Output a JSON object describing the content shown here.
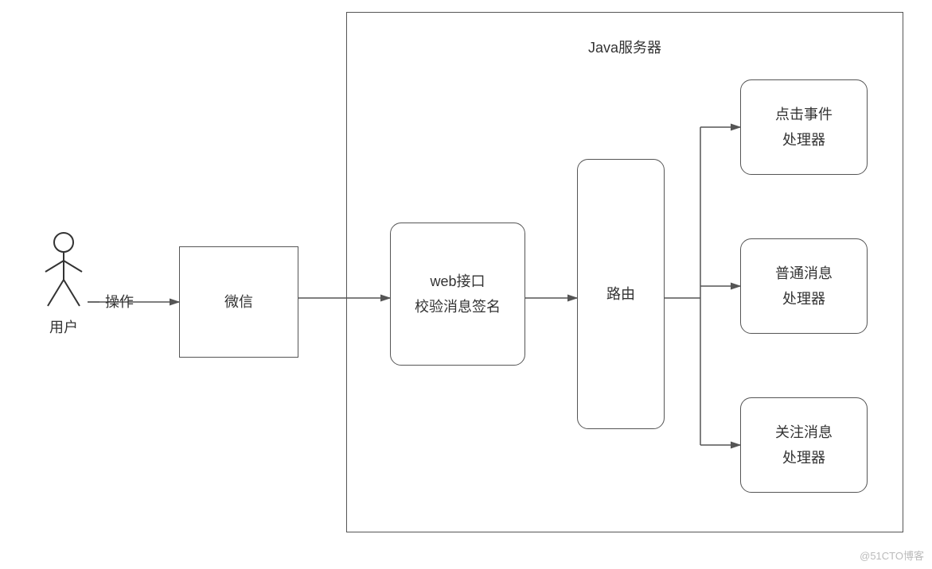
{
  "actor": {
    "label": "用户"
  },
  "edge_operate": "操作",
  "wechat": {
    "label": "微信"
  },
  "server": {
    "title": "Java服务器"
  },
  "web": {
    "line1": "web接口",
    "line2": "校验消息签名"
  },
  "router": {
    "label": "路由"
  },
  "handlers": {
    "click": {
      "line1": "点击事件",
      "line2": "处理器"
    },
    "normal": {
      "line1": "普通消息",
      "line2": "处理器"
    },
    "follow": {
      "line1": "关注消息",
      "line2": "处理器"
    }
  },
  "watermark": "@51CTO博客"
}
